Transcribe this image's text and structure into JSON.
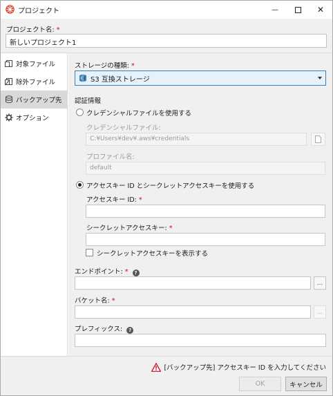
{
  "window": {
    "title": "プロジェクト",
    "minimize_glyph": "—",
    "maximize_glyph": "☐",
    "close_glyph": "✕"
  },
  "project": {
    "label": "プロジェクト名:",
    "required_mark": "*",
    "value": "新しいプロジェクト1"
  },
  "sidebar": {
    "items": [
      {
        "label": "対象ファイル",
        "icon": "file-icon",
        "active": false
      },
      {
        "label": "除外ファイル",
        "icon": "exclude-file-icon",
        "active": false
      },
      {
        "label": "バックアップ先",
        "icon": "database-icon",
        "active": true
      },
      {
        "label": "オプション",
        "icon": "gear-icon",
        "active": false
      }
    ]
  },
  "storage": {
    "label": "ストレージの種類:",
    "required_mark": "*",
    "selected": "S3 互換ストレージ",
    "icon": "s3-bucket-icon"
  },
  "auth": {
    "section_label": "認証情報",
    "credential_file_option": "クレデンシャルファイルを使用する",
    "credential_file_label": "クレデンシャルファイル:",
    "credential_file_value": "C:¥Users¥dev¥.aws¥credentials",
    "profile_label": "プロファイル名:",
    "profile_value": "default",
    "access_key_option": "アクセスキー ID とシークレットアクセスキーを使用する",
    "access_key_label": "アクセスキー ID:",
    "access_key_value": "",
    "secret_key_label": "シークレットアクセスキー:",
    "secret_key_value": "",
    "show_secret_label": "シークレットアクセスキーを表示する",
    "selected_option": "access_key"
  },
  "endpoint": {
    "label": "エンドポイント:",
    "required_mark": "*",
    "value": "",
    "browse_label": "..."
  },
  "bucket": {
    "label": "バケット名:",
    "required_mark": "*",
    "value": "",
    "browse_label": "..."
  },
  "prefix": {
    "label": "プレフィックス:",
    "value": ""
  },
  "footer": {
    "message": "[バックアップ先] アクセスキー ID を入力してください",
    "ok_label": "OK",
    "cancel_label": "キャンセル"
  },
  "colors": {
    "accent": "#3c7fb1",
    "required": "#d0021b",
    "warning": "#d0021b",
    "app_icon": "#e0523a"
  }
}
